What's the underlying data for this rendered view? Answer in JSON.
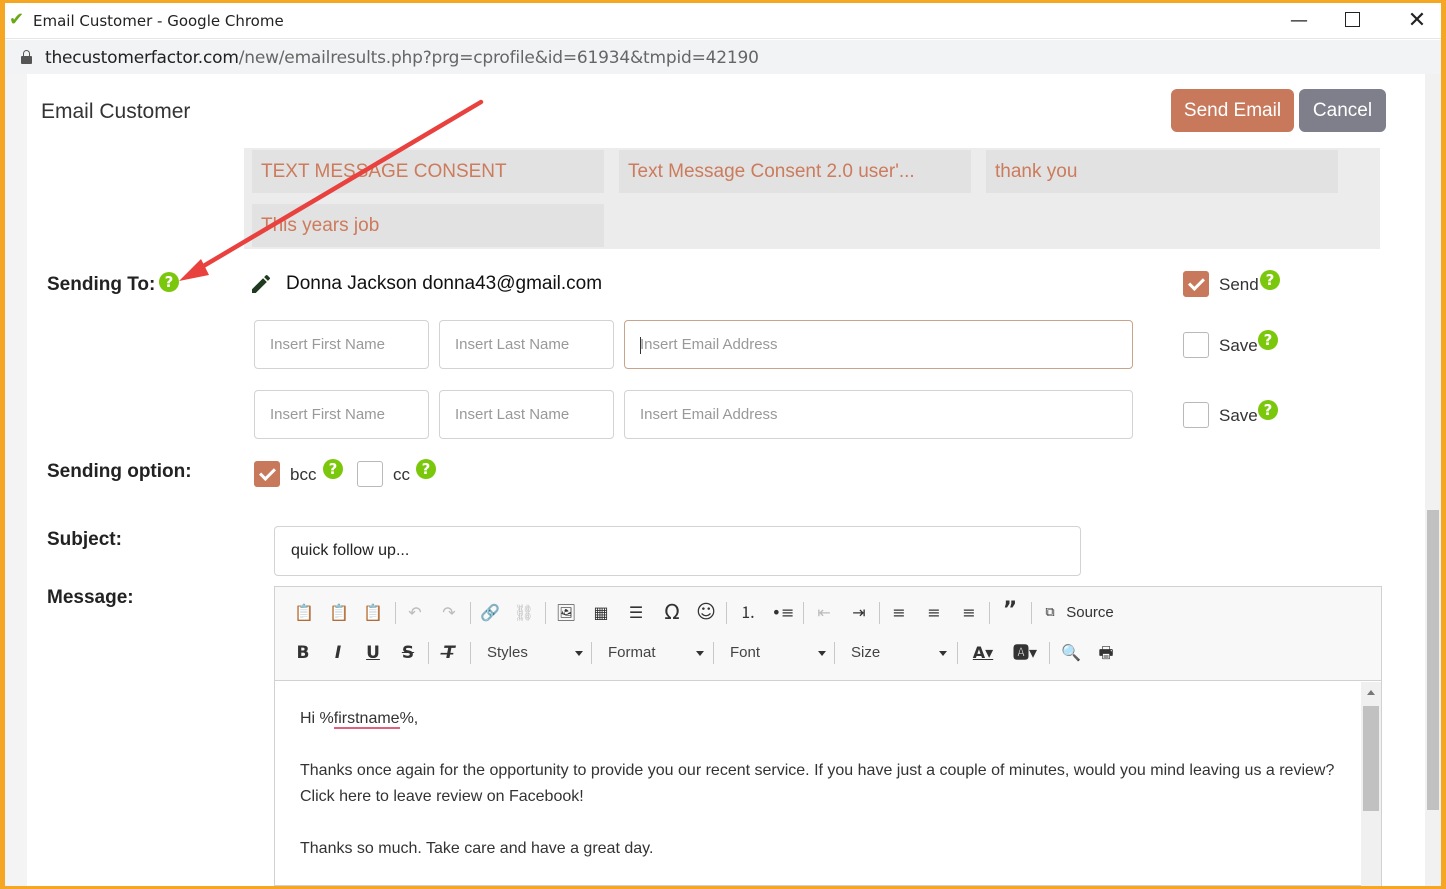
{
  "browser": {
    "window_title": "Email Customer - Google Chrome",
    "url_host": "thecustomerfactor.com",
    "url_path": "/new/emailresults.php?prg=cprofile&id=61934&tmpid=42190"
  },
  "header": {
    "title": "Email Customer",
    "send_label": "Send Email",
    "cancel_label": "Cancel"
  },
  "templates": [
    "TEXT MESSAGE CONSENT",
    "Text Message Consent 2.0 user'...",
    "thank you",
    "This years job"
  ],
  "sending_to": {
    "label": "Sending To:",
    "recipient": "Donna Jackson donna43@gmail.com",
    "send_checked": true,
    "send_label": "Send",
    "save_label": "Save",
    "rows": [
      {
        "first_placeholder": "Insert First Name",
        "last_placeholder": "Insert Last Name",
        "email_placeholder": "Insert Email Address",
        "save_checked": false
      },
      {
        "first_placeholder": "Insert First Name",
        "last_placeholder": "Insert Last Name",
        "email_placeholder": "Insert Email Address",
        "save_checked": false
      }
    ]
  },
  "sending_option": {
    "label": "Sending option:",
    "bcc_label": "bcc",
    "bcc_checked": true,
    "cc_label": "cc",
    "cc_checked": false
  },
  "subject": {
    "label": "Subject:",
    "value": "quick follow up..."
  },
  "message": {
    "label": "Message:",
    "toolbar": {
      "source_label": "Source",
      "styles_label": "Styles",
      "format_label": "Format",
      "font_label": "Font",
      "size_label": "Size"
    },
    "greeting_prefix": "Hi %",
    "greeting_token": "firstname",
    "greeting_suffix": "%,",
    "paragraph_1": "Thanks once again for the opportunity to provide you our recent service. If you have just a couple of minutes, would you mind leaving us a review? Click here to leave review on Facebook!",
    "paragraph_2": "Thanks so much. Take care and have a great day."
  },
  "colors": {
    "accent": "#c8785b",
    "help": "#7ac70c",
    "annotation_arrow": "#e8413e",
    "frame": "#f5a623"
  }
}
